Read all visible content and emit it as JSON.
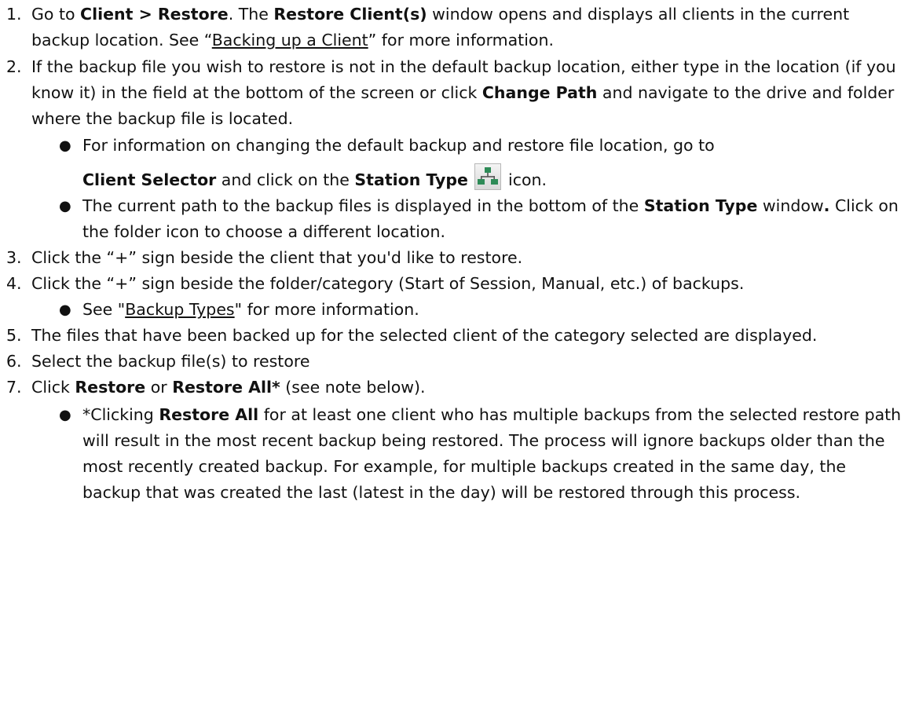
{
  "steps": [
    {
      "num": "1.",
      "parts": [
        "Go to ",
        "Client > Restore",
        ". The ",
        "Restore Client(s)",
        " window opens and displays all clients in the current backup location. See “",
        "Backing up a Client",
        "” for more information."
      ]
    },
    {
      "num": "2.",
      "parts": [
        "If the backup file you wish to restore is not in the default backup location, either type in the location (if you know it) in the field at the bottom of the screen or click ",
        "Change Path",
        " and navigate to the drive and folder where the backup file is located."
      ],
      "bullets": [
        {
          "parts": [
            "For information on changing the default backup and restore file location, go to",
            "Client Selector",
            " and click on the ",
            "Station Type",
            "icon."
          ]
        },
        {
          "parts": [
            "The current path to the backup files is displayed in the bottom of the ",
            "Station Type",
            " window",
            ".",
            " Click on the folder icon to choose a different location."
          ]
        }
      ]
    },
    {
      "num": "3.",
      "parts": [
        "Click the “+” sign beside the client that you'd like to restore."
      ]
    },
    {
      "num": "4.",
      "parts": [
        "Click the “+” sign beside the folder/category (Start of Session, Manual, etc.) of backups."
      ],
      "bullets": [
        {
          "parts": [
            "See \"",
            "Backup Types",
            "\" for more information."
          ]
        }
      ]
    },
    {
      "num": "5.",
      "parts": [
        "The files that have been backed up for the selected client of the category selected are displayed."
      ]
    },
    {
      "num": "6.",
      "parts": [
        "Select the backup file(s) to restore"
      ]
    },
    {
      "num": "7.",
      "parts": [
        "Click ",
        "Restore",
        " or ",
        "Restore All*",
        " (see note below)."
      ],
      "bullets": [
        {
          "parts": [
            "*Clicking ",
            "Restore All",
            " for at least one client who has multiple backups from the selected restore path will result in the most recent backup being restored. The process will ignore backups older than the most recently created backup. For example, for multiple backups created in the same day, the backup that was created the last (latest in the day) will be restored through this process."
          ]
        }
      ]
    }
  ],
  "icons": {
    "station_type": "station-type-network-icon"
  },
  "colors": {
    "icon_green": "#2e8b57",
    "icon_frame": "#b7b7b7"
  }
}
